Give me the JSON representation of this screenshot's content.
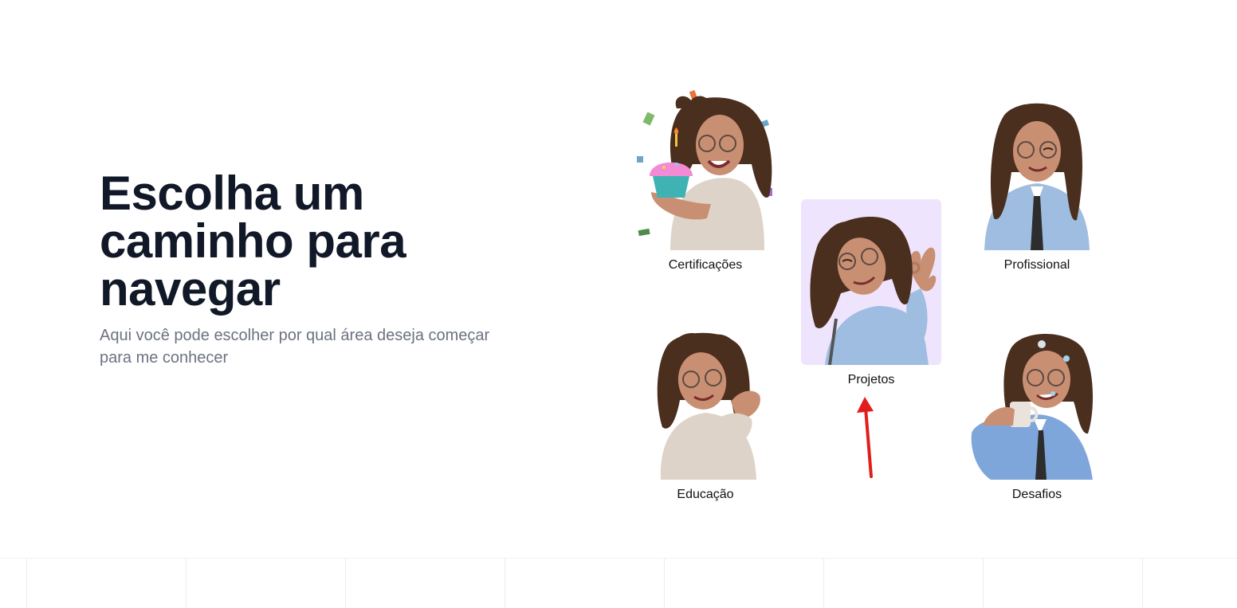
{
  "hero": {
    "title": "Escolha um caminho para navegar",
    "subtitle": "Aqui você pode escolher por qual área deseja começar para me conhecer"
  },
  "paths": [
    {
      "label": "Certificações",
      "icon": "avatar-cupcake-celebration",
      "active": false
    },
    {
      "label": "Profissional",
      "icon": "avatar-winking-tie",
      "active": false
    },
    {
      "label": "Projetos",
      "icon": "avatar-ok-hand",
      "active": true
    },
    {
      "label": "Educação",
      "icon": "avatar-hands-clasped",
      "active": false
    },
    {
      "label": "Desafios",
      "icon": "avatar-coffee-mug",
      "active": false
    }
  ],
  "colors": {
    "title": "#111827",
    "subtitle": "#6b7280",
    "active_card_bg": "#efe4fd",
    "annotation_arrow": "#e11d1d",
    "hair": "#4a2e1e",
    "skin": "#c98f73",
    "sweater": "#ddd3c8",
    "shirt": "#9fbde0"
  }
}
